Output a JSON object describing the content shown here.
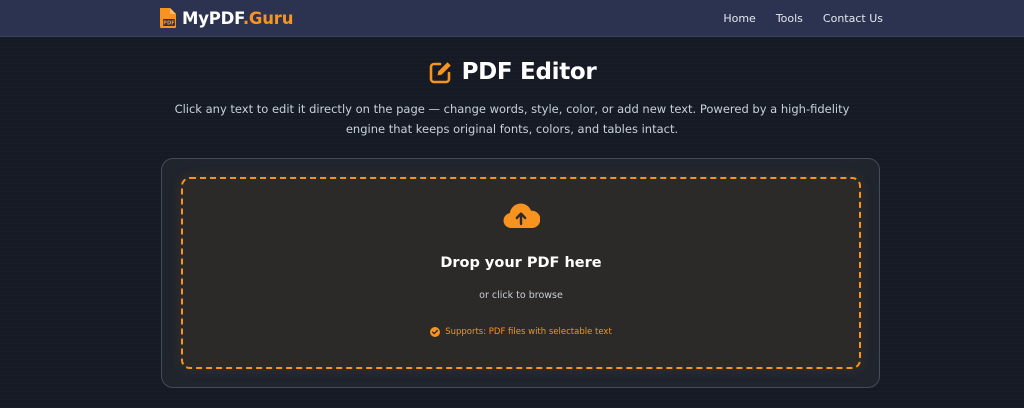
{
  "navbar": {
    "brand_main": "MyPDF",
    "brand_accent": ".Guru",
    "brand_icon": "pdf-file-icon",
    "links": [
      {
        "label": "Home"
      },
      {
        "label": "Tools"
      },
      {
        "label": "Contact Us"
      }
    ]
  },
  "hero": {
    "icon": "edit-icon",
    "title": "PDF Editor",
    "subtitle": "Click any text to edit it directly on the page — change words, style, color, or add new text. Powered by a high-fidelity engine that keeps original fonts, colors, and tables intact."
  },
  "upload": {
    "icon": "cloud-upload-icon",
    "title": "Drop your PDF here",
    "subtitle": "or click to browse",
    "supports_icon": "check-circle-icon",
    "supports": "Supports: PDF files with selectable text"
  },
  "colors": {
    "accent": "#f7931e",
    "navbar_bg": "#2c3350",
    "page_bg": "#151a24",
    "card_bg": "#1f242d",
    "dropzone_bg": "#2c2a28"
  }
}
